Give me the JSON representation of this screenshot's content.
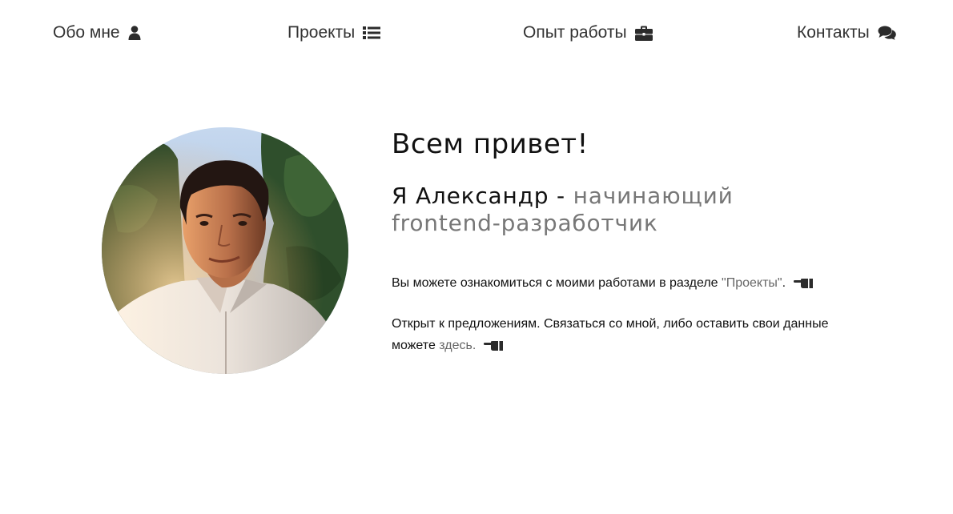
{
  "nav": {
    "items": [
      {
        "label": "Обо мне",
        "icon": "user-icon"
      },
      {
        "label": "Проекты",
        "icon": "list-icon"
      },
      {
        "label": "Опыт работы",
        "icon": "briefcase-icon"
      },
      {
        "label": "Контакты",
        "icon": "comments-icon"
      }
    ]
  },
  "hero": {
    "greeting": "Всем привет!",
    "name_line": "Я Александр - ",
    "role_line": "начинающий frontend-разработчик",
    "projects_text": "Вы можете ознакомиться с моими работами в разделе ",
    "projects_link": "\"Проекты\"",
    "projects_tail": ".",
    "contact_text": "Открыт к предложениям. Связаться со мной, либо оставить свои данные можете ",
    "contact_link": "здесь.",
    "pointer_icon": "hand-pointing-icon"
  },
  "colors": {
    "accent_text": "#111111",
    "muted_text": "#777777",
    "link_text": "#666666",
    "background": "#ffffff"
  }
}
